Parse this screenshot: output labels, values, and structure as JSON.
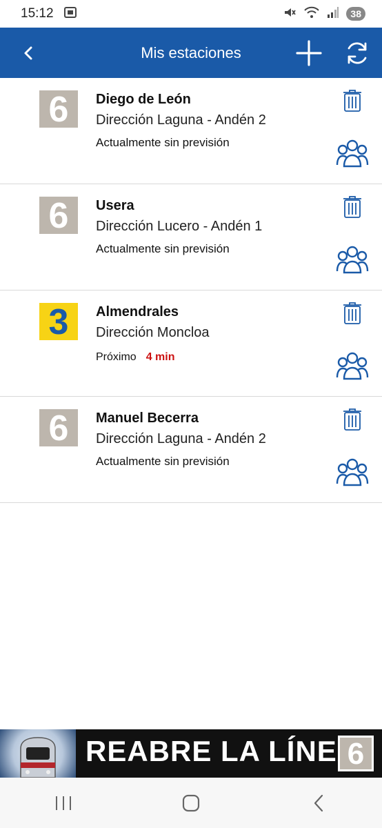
{
  "status_bar": {
    "time": "15:12",
    "battery": "38",
    "icons": [
      "screenshot-icon",
      "mute-icon",
      "wifi-icon",
      "signal-icon"
    ]
  },
  "app_bar": {
    "title": "Mis estaciones",
    "back_icon": "back-arrow-icon",
    "add_icon": "plus-icon",
    "refresh_icon": "refresh-icon",
    "color": "#1a5aa8"
  },
  "stations": [
    {
      "line": "6",
      "line_color": "#bdb6ad",
      "name": "Diego de León",
      "direction": "Dirección Laguna - Andén 2",
      "prediction": "Actualmente sin previsión",
      "minutes": ""
    },
    {
      "line": "6",
      "line_color": "#bdb6ad",
      "name": "Usera",
      "direction": "Dirección Lucero - Andén 1",
      "prediction": "Actualmente sin previsión",
      "minutes": ""
    },
    {
      "line": "3",
      "line_color": "#f7d315",
      "name": "Almendrales",
      "direction": "Dirección Moncloa",
      "prediction": "Próximo",
      "minutes": "4 min"
    },
    {
      "line": "6",
      "line_color": "#bdb6ad",
      "name": "Manuel Becerra",
      "direction": "Dirección Laguna - Andén 2",
      "prediction": "Actualmente sin previsión",
      "minutes": ""
    }
  ],
  "banner": {
    "text": "REABRE LA LÍNEA",
    "line": "6"
  },
  "nav_bar": {
    "icons": [
      "recent-apps-icon",
      "home-icon",
      "back-icon"
    ]
  }
}
